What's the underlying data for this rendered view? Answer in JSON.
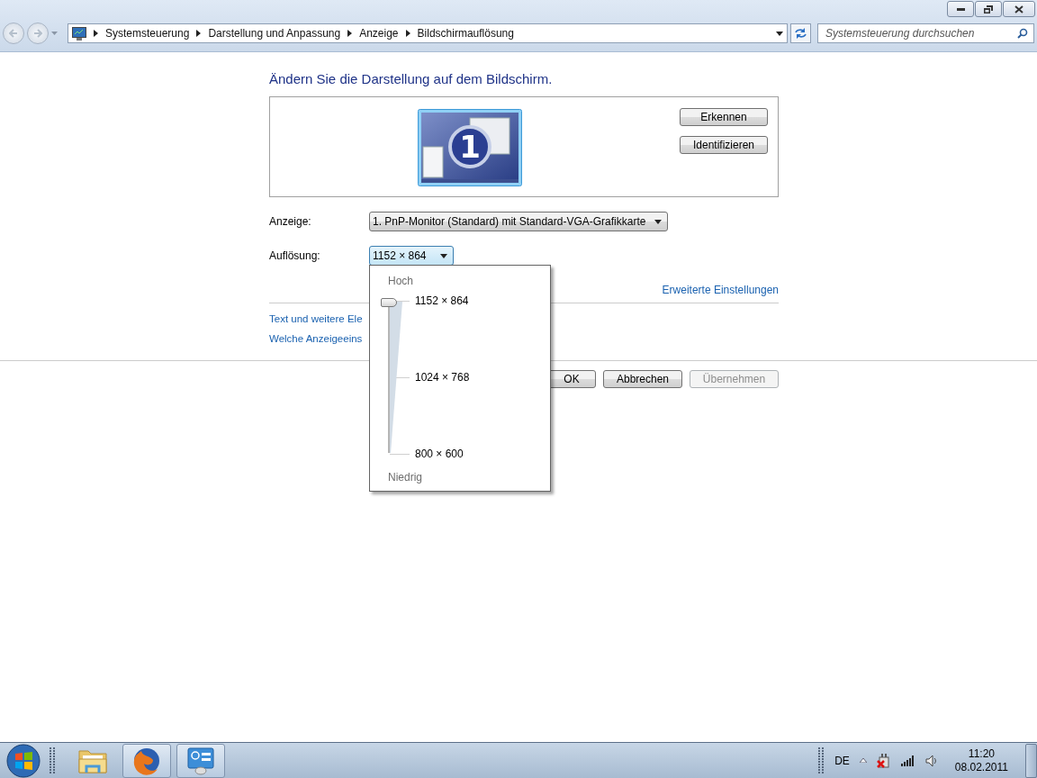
{
  "address_bar": {
    "breadcrumbs": [
      "Systemsteuerung",
      "Darstellung und Anpassung",
      "Anzeige",
      "Bildschirmauflösung"
    ]
  },
  "search": {
    "placeholder": "Systemsteuerung durchsuchen"
  },
  "heading": "Ändern Sie die Darstellung auf dem Bildschirm.",
  "monitor": {
    "number": "1"
  },
  "monitor_buttons": [
    "Erkennen",
    "Identifizieren"
  ],
  "display_field": {
    "label": "Anzeige:",
    "value": "1. PnP-Monitor (Standard) mit Standard-VGA-Grafikkarte"
  },
  "resolution_field": {
    "label": "Auflösung:",
    "value": "1152 × 864",
    "expanded": true
  },
  "resolution_popup": {
    "high_label": "Hoch",
    "low_label": "Niedrig",
    "ticks": [
      "1152 × 864",
      "1024 × 768",
      "800 × 600"
    ],
    "level": 1
  },
  "advanced_link": "Erweiterte Einstellungen",
  "links": [
    "Text und weitere Ele",
    "Welche Anzeigeeins"
  ],
  "buttons": [
    {
      "label": "OK",
      "disabled": false
    },
    {
      "label": "Abbrechen",
      "disabled": false
    },
    {
      "label": "Übernehmen",
      "disabled": true
    }
  ],
  "taskbar": {
    "apps": [
      {
        "running": false
      },
      {
        "running": true
      },
      {
        "running": true
      }
    ]
  },
  "tray": {
    "language": "DE",
    "time": "11:20",
    "date": "08.02.2011"
  }
}
